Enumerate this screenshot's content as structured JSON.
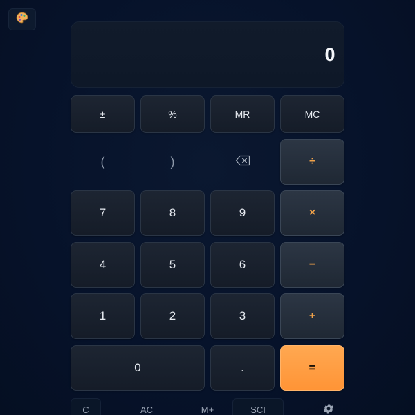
{
  "display": {
    "value": "0"
  },
  "theme_button": {
    "icon": "palette-icon"
  },
  "keys": {
    "row1": [
      "±",
      "%",
      "MR",
      "MC"
    ],
    "paren_open": "(",
    "paren_close": ")",
    "backspace_icon": "backspace-icon",
    "divide": "÷",
    "seven": "7",
    "eight": "8",
    "nine": "9",
    "multiply": "×",
    "four": "4",
    "five": "5",
    "six": "6",
    "minus": "−",
    "one": "1",
    "two": "2",
    "three": "3",
    "plus": "+",
    "zero": "0",
    "decimal": ".",
    "equals": "="
  },
  "bottom_bar": {
    "clear": "C",
    "all_clear": "AC",
    "memory_add": "M+",
    "scientific": "SCI",
    "settings_icon": "gear-icon"
  },
  "colors": {
    "accent": "#ff9a3d",
    "operator_text": "#f0a24a",
    "background": "#061226"
  }
}
